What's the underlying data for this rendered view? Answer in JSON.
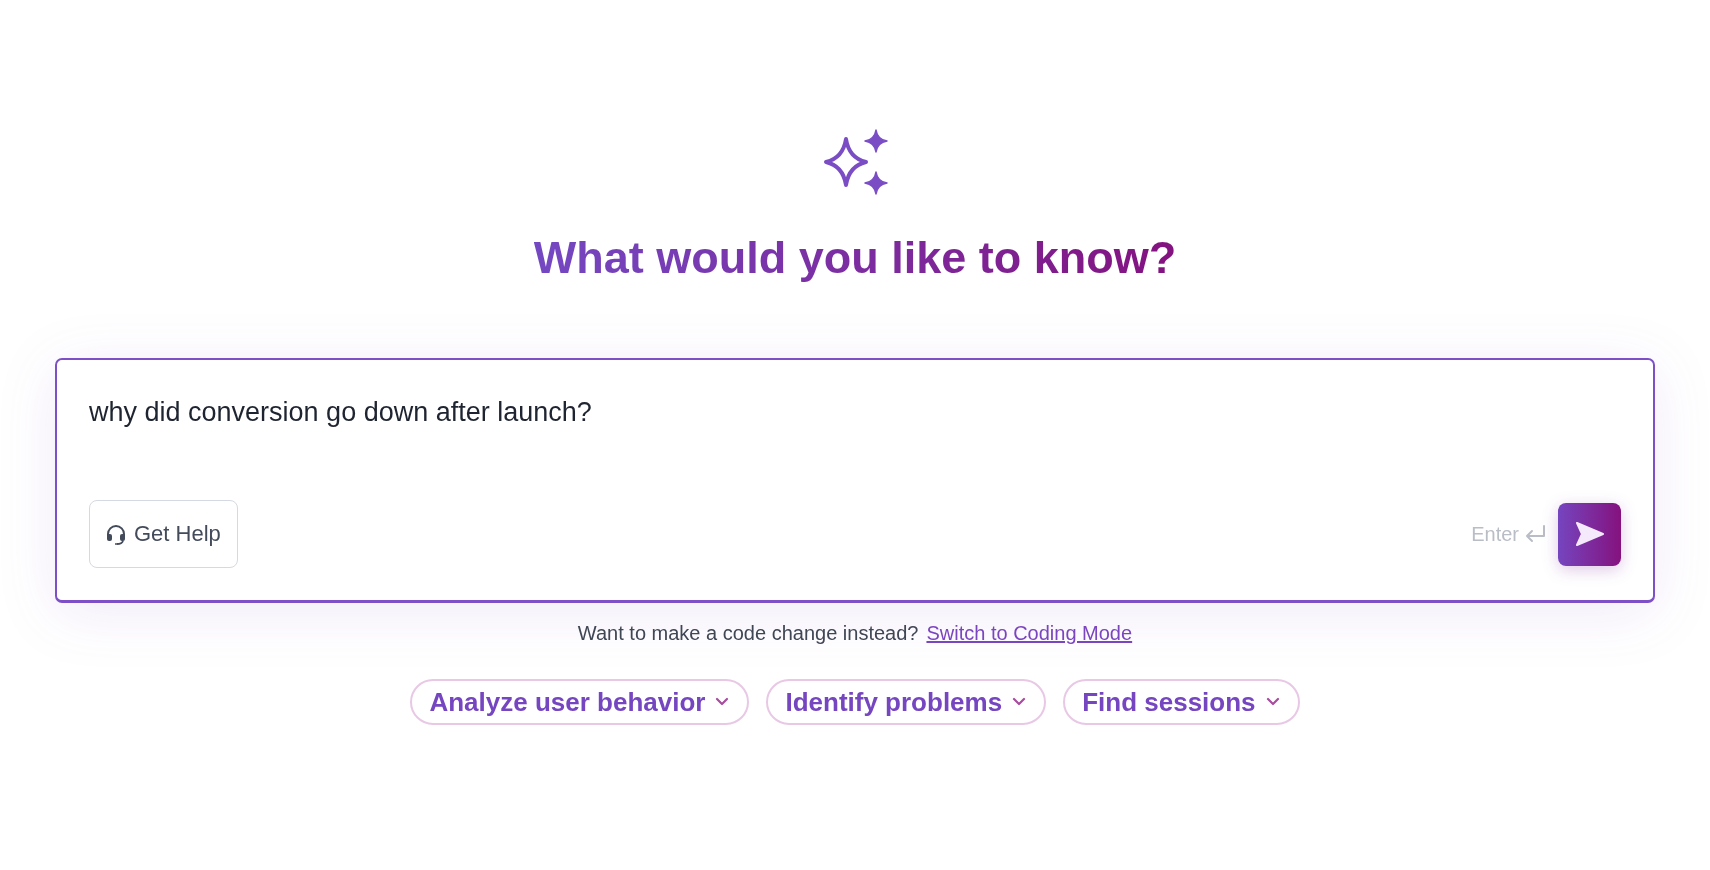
{
  "hero": {
    "title": "What would you like to know?"
  },
  "prompt_box": {
    "value": "why did conversion go down after launch?",
    "help_button": "Get Help",
    "enter_hint": "Enter"
  },
  "mode_hint": {
    "text": "Want to make a code change instead?",
    "link": "Switch to Coding Mode"
  },
  "suggestions": [
    {
      "label": "Analyze user behavior"
    },
    {
      "label": "Identify problems"
    },
    {
      "label": "Find sessions"
    }
  ]
}
